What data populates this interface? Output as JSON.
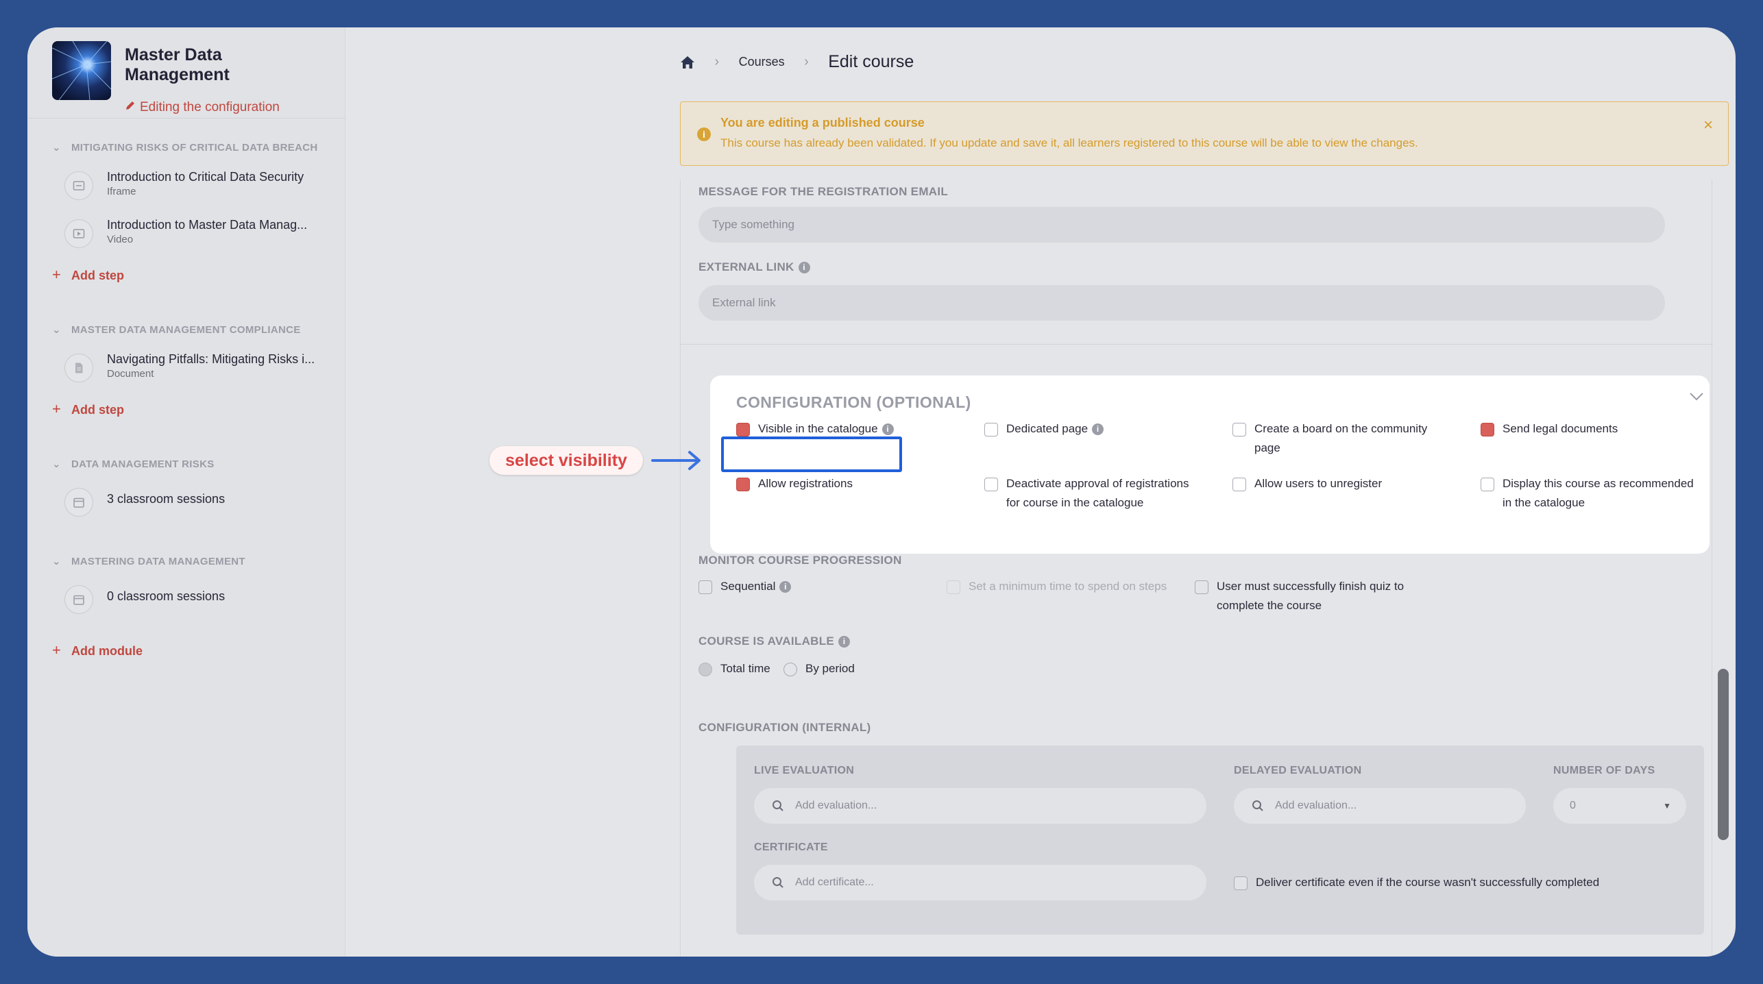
{
  "sidebar": {
    "title": "Master Data Management",
    "subtitle": "Editing the configuration",
    "modules": [
      {
        "name": "MITIGATING RISKS OF CRITICAL DATA BREACH",
        "steps": [
          {
            "title": "Introduction to Critical Data Security",
            "type": "Iframe",
            "icon": "iframe-icon"
          },
          {
            "title": "Introduction to Master Data Manag...",
            "type": "Video",
            "icon": "video-icon"
          }
        ],
        "add_label": "Add step"
      },
      {
        "name": "MASTER DATA MANAGEMENT COMPLIANCE",
        "steps": [
          {
            "title": "Navigating Pitfalls: Mitigating Risks i...",
            "type": "Document",
            "icon": "document-icon"
          }
        ],
        "add_label": "Add step"
      },
      {
        "name": "DATA MANAGEMENT RISKS",
        "steps": [
          {
            "title": "3 classroom sessions",
            "type": "",
            "icon": "calendar-icon"
          }
        ]
      },
      {
        "name": "MASTERING DATA MANAGEMENT",
        "steps": [
          {
            "title": "0 classroom sessions",
            "type": "",
            "icon": "calendar-icon"
          }
        ]
      }
    ],
    "add_module_label": "Add module"
  },
  "breadcrumb": {
    "courses": "Courses",
    "current": "Edit course"
  },
  "alert": {
    "title": "You are editing a published course",
    "message": "This course has already been validated. If you update and save it, all learners registered to this course will be able to view the changes.",
    "icon": "info-icon",
    "color": "#d59b2b"
  },
  "form": {
    "registration_email": {
      "label": "MESSAGE FOR THE REGISTRATION EMAIL",
      "placeholder": "Type something"
    },
    "external_link": {
      "label": "EXTERNAL LINK",
      "placeholder": "External link"
    },
    "config_optional": {
      "title": "CONFIGURATION (OPTIONAL)",
      "options": [
        {
          "label": "Visible in the catalogue",
          "checked": true
        },
        {
          "label": "Dedicated page",
          "checked": false
        },
        {
          "label": "Create a board on the community page",
          "checked": false
        },
        {
          "label": "Send legal documents",
          "checked": true
        },
        {
          "label": "Allow registrations",
          "checked": true
        },
        {
          "label": "Deactivate approval of registrations for course in the catalogue",
          "checked": false
        },
        {
          "label": "Allow users to unregister",
          "checked": false
        },
        {
          "label": "Display this course as recommended in the catalogue",
          "checked": false
        }
      ]
    },
    "monitor": {
      "title": "MONITOR COURSE PROGRESSION",
      "sequential": "Sequential",
      "min_time": "Set a minimum time to spend on steps",
      "quiz": "User must successfully finish quiz to complete the course"
    },
    "availability": {
      "title": "COURSE IS AVAILABLE",
      "total_time": "Total time",
      "by_period": "By period"
    },
    "config_internal": {
      "title": "CONFIGURATION (INTERNAL)",
      "live_evaluation": {
        "label": "LIVE EVALUATION",
        "placeholder": "Add evaluation..."
      },
      "delayed_evaluation": {
        "label": "DELAYED EVALUATION",
        "placeholder": "Add evaluation..."
      },
      "number_of_days": {
        "label": "NUMBER OF DAYS",
        "value": "0"
      },
      "certificate": {
        "label": "CERTIFICATE",
        "placeholder": "Add certificate..."
      },
      "deliver_certificate": "Deliver certificate even if the course wasn't successfully completed"
    }
  },
  "annotation": {
    "callout": "select visibility",
    "highlight_color": "#1f5fd9"
  },
  "colors": {
    "accent": "#c0473f",
    "checked": "#d95f5a",
    "background": "#2c4f8e"
  }
}
